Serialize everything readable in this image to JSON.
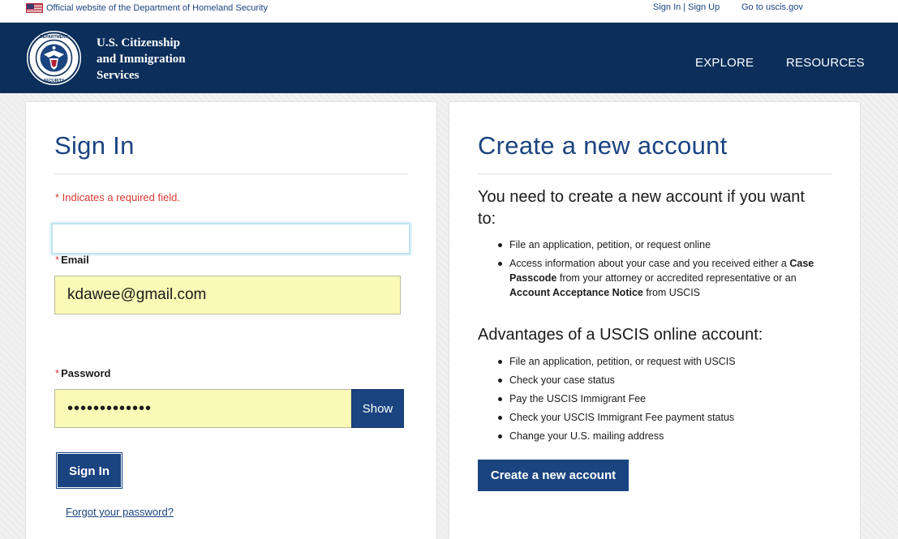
{
  "topbar": {
    "official_text": "Official website of the Department of Homeland Security",
    "sign_in": "Sign In",
    "separator": "|",
    "sign_up": "Sign Up",
    "go_to": "Go to uscis.gov"
  },
  "header": {
    "agency_line1": "U.S. Citizenship",
    "agency_line2": "and Immigration",
    "agency_line3": "Services",
    "nav_explore": "EXPLORE",
    "nav_resources": "RESOURCES"
  },
  "signin": {
    "title": "Sign In",
    "required_note": "* Indicates a required field.",
    "email_label_star": "*",
    "email_label": "Email",
    "email_value": "kdawee@gmail.com",
    "password_label_star": "*",
    "password_label": "Password",
    "password_masked": "•••••••••••••",
    "show_label": "Show",
    "submit_label": "Sign In",
    "forgot_label": "Forgot your password?"
  },
  "create": {
    "title": "Create a new account",
    "need_heading": "You need to create a new account if you want to:",
    "need_item1": "File an application, petition, or request online",
    "need_item2_a": "Access information about your case and you received either a ",
    "need_item2_b": "Case Passcode",
    "need_item2_c": " from your attorney or accredited representative or an ",
    "need_item2_d": "Account Acceptance Notice",
    "need_item2_e": " from USCIS",
    "adv_heading": "Advantages of a USCIS online account:",
    "adv_items": [
      "File an application, petition, or request with USCIS",
      "Check your case status",
      "Pay the USCIS Immigrant Fee",
      "Check your USCIS Immigrant Fee payment status",
      "Change your U.S. mailing address"
    ],
    "button_label": "Create a new account"
  },
  "colors": {
    "header_bg": "#0b2e5a",
    "primary": "#1a4480",
    "required": "#d83933",
    "autofill": "#fafab7"
  },
  "icons": {
    "flag": "us-flag-icon",
    "seal": "dhs-seal-icon"
  }
}
